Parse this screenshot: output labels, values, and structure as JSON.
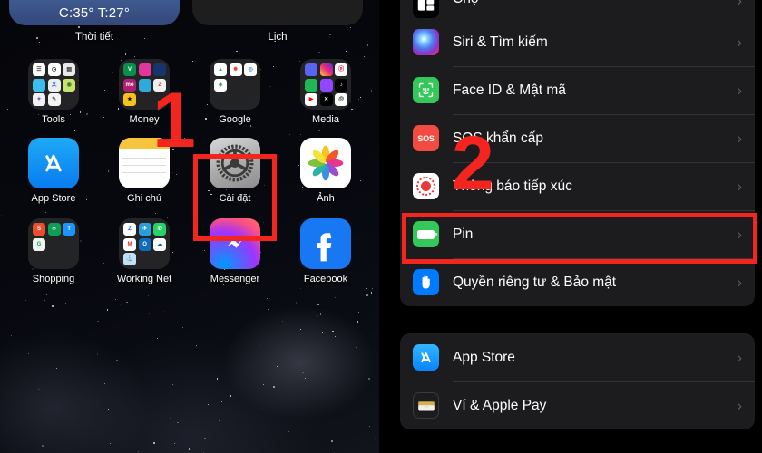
{
  "home_screen": {
    "widgets": [
      {
        "label": "Thời tiết",
        "value": "C:35° T:27°",
        "icon": "weather-widget"
      },
      {
        "label": "Lịch",
        "value": "",
        "icon": "calendar-widget"
      }
    ],
    "rows": [
      [
        {
          "label": "Tools",
          "type": "folder",
          "icon": "folder-tools"
        },
        {
          "label": "Money",
          "type": "folder",
          "icon": "folder-money"
        },
        {
          "label": "Google",
          "type": "folder",
          "icon": "folder-google"
        },
        {
          "label": "Media",
          "type": "folder",
          "icon": "folder-media"
        }
      ],
      [
        {
          "label": "App Store",
          "type": "app",
          "icon": "app-store-icon"
        },
        {
          "label": "Ghi chú",
          "type": "app",
          "icon": "notes-icon"
        },
        {
          "label": "Cài đặt",
          "type": "app",
          "icon": "settings-gear-icon"
        },
        {
          "label": "Ảnh",
          "type": "app",
          "icon": "photos-icon"
        }
      ],
      [
        {
          "label": "Shopping",
          "type": "folder",
          "icon": "folder-shopping"
        },
        {
          "label": "Working Net",
          "type": "folder",
          "icon": "folder-working-net"
        },
        {
          "label": "Messenger",
          "type": "app",
          "icon": "messenger-icon"
        },
        {
          "label": "Facebook",
          "type": "app",
          "icon": "facebook-icon"
        }
      ]
    ]
  },
  "settings": {
    "groups": [
      {
        "rows": [
          {
            "label": "Chợ",
            "icon": "market-icon",
            "chevron": "›",
            "partial": true
          },
          {
            "label": "Siri & Tìm kiếm",
            "icon": "siri-icon",
            "chevron": "›"
          },
          {
            "label": "Face ID & Mật mã",
            "icon": "faceid-icon",
            "chevron": "›"
          },
          {
            "label": "SOS khẩn cấp",
            "icon": "sos-icon",
            "chevron": "›"
          },
          {
            "label": "Thông báo tiếp xúc",
            "icon": "exposure-notification-icon",
            "chevron": "›"
          },
          {
            "label": "Pin",
            "icon": "battery-icon",
            "chevron": "›",
            "highlighted": true
          },
          {
            "label": "Quyền riêng tư & Bảo mật",
            "icon": "privacy-hand-icon",
            "chevron": "›"
          }
        ]
      },
      {
        "rows": [
          {
            "label": "App Store",
            "icon": "app-store-icon",
            "chevron": "›"
          },
          {
            "label": "Ví & Apple Pay",
            "icon": "wallet-icon",
            "chevron": "›"
          }
        ]
      }
    ],
    "sos_badge": "SOS"
  },
  "annotations": {
    "step_one": "1",
    "step_two": "2",
    "accent_color": "#f4251f",
    "highlight_settings_app": "Cài đặt",
    "highlight_battery_row": "Pin"
  }
}
